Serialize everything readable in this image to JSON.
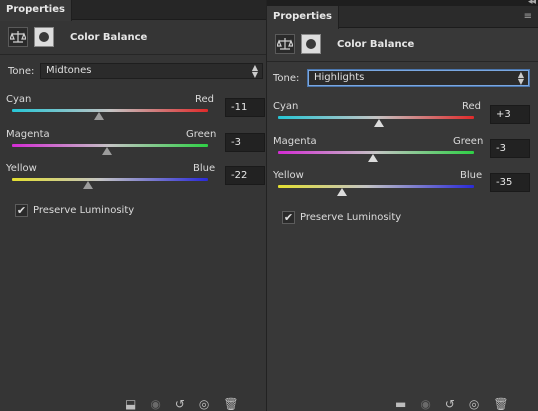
{
  "left": {
    "tab": "Properties",
    "title": "Color Balance",
    "tone_label": "Tone:",
    "tone_value": "Midtones",
    "sliders": [
      {
        "left": "Cyan",
        "right": "Red",
        "value": "-11",
        "level": -11
      },
      {
        "left": "Magenta",
        "right": "Green",
        "value": "-3",
        "level": -3
      },
      {
        "left": "Yellow",
        "right": "Blue",
        "value": "-22",
        "level": -22
      }
    ],
    "preserve_label": "Preserve Luminosity",
    "preserve_checked": true
  },
  "right": {
    "tab": "Properties",
    "title": "Color Balance",
    "tone_label": "Tone:",
    "tone_value": "Highlights",
    "sliders": [
      {
        "left": "Cyan",
        "right": "Red",
        "value": "+3",
        "level": 3
      },
      {
        "left": "Magenta",
        "right": "Green",
        "value": "-3",
        "level": -3
      },
      {
        "left": "Yellow",
        "right": "Blue",
        "value": "-35",
        "level": -35
      }
    ],
    "preserve_label": "Preserve Luminosity",
    "preserve_checked": true
  },
  "icons": {
    "check": "✔",
    "select_arrows": "▲▼",
    "collapse": "◂◂",
    "menu": "≡"
  },
  "colors": {
    "panel_bg": "#353535",
    "focus_border": "#7aa7e0"
  }
}
